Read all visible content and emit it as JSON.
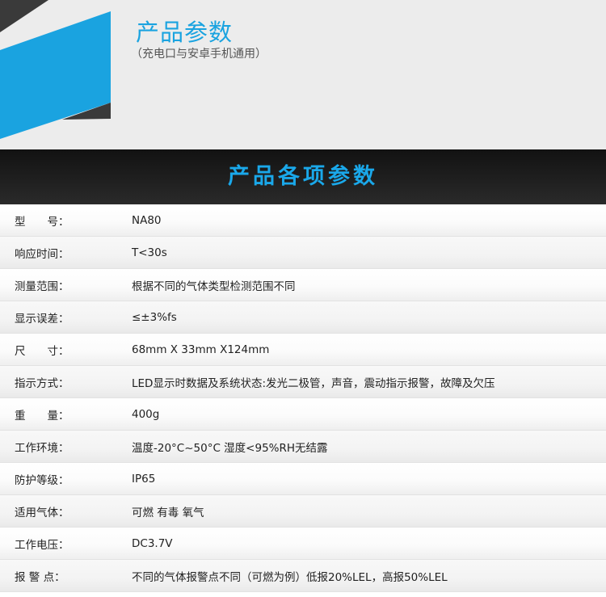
{
  "header": {
    "title": "产品参数",
    "subtitle": "（充电口与安卓手机通用）",
    "colors": {
      "accent": "#1aa3e0",
      "dark": "#3a3a3a"
    }
  },
  "band": {
    "title": "产品各项参数"
  },
  "specs": [
    {
      "label": "型　　号：",
      "value": "NA80"
    },
    {
      "label": "响应时间：",
      "value": "T<30s"
    },
    {
      "label": "测量范围：",
      "value": "根据不同的气体类型检测范围不同"
    },
    {
      "label": "显示误差：",
      "value": "≤±3%fs"
    },
    {
      "label": "尺　　寸：",
      "value": "68mm X 33mm X124mm"
    },
    {
      "label": "指示方式：",
      "value": "LED显示时数据及系统状态:发光二极管，声音，震动指示报警，故障及欠压"
    },
    {
      "label": "重　　量：",
      "value": "400g"
    },
    {
      "label": "工作环境：",
      "value": "温度-20°C~50°C 湿度<95%RH无结露"
    },
    {
      "label": "防护等级：",
      "value": "IP65"
    },
    {
      "label": "适用气体：",
      "value": "可燃 有毒 氧气"
    },
    {
      "label": "工作电压：",
      "value": "DC3.7V"
    },
    {
      "label": "报 警 点：",
      "value": "不同的气体报警点不同（可燃为例）低报20%LEL，高报50%LEL"
    }
  ]
}
